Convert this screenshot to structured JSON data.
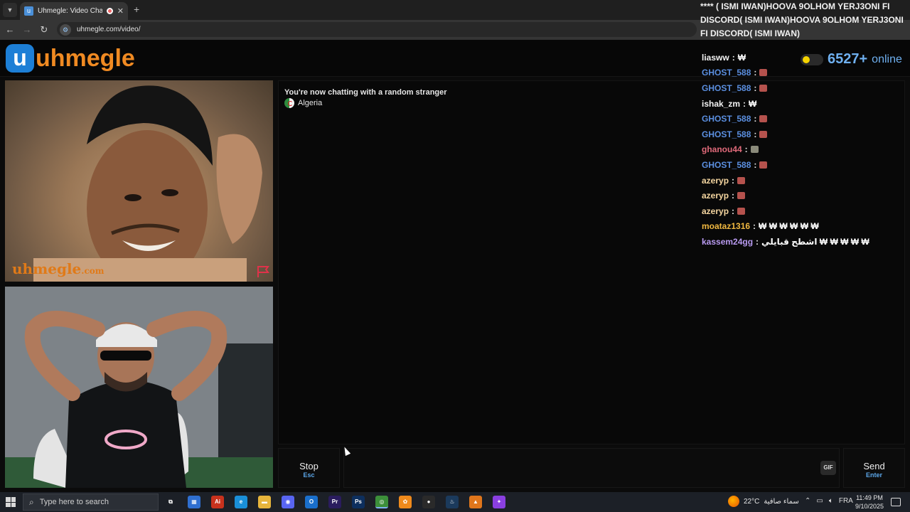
{
  "browser": {
    "tab_title": "Uhmegle: Video Chat | Ome",
    "tab_close": "✕",
    "new_tab": "+",
    "url": "uhmegle.com/video/"
  },
  "site": {
    "logo_mark": "u",
    "logo_text": "uhmegle",
    "online_count": "6527+",
    "online_label": "online"
  },
  "video": {
    "watermark_main": "uhmegle",
    "watermark_sub": ".com"
  },
  "chat": {
    "status": "You're now chatting with a random stranger",
    "country": "Algeria"
  },
  "overlay": {
    "top_text": "**** ( ISMI IWAN)HOOVA 9OLHOM YERJ3ONI FI DISCORD( ISMI IWAN)HOOVA 9OLHOM YERJ3ONI FI DISCORD( ISMI IWAN)",
    "feed": [
      {
        "user": "liasww",
        "color": "#f2f2f2",
        "msg": "₩",
        "emote": ""
      },
      {
        "user": "GHOST_588",
        "color": "#5b8fe0",
        "msg": "",
        "emote": "#b5524d"
      },
      {
        "user": "GHOST_588",
        "color": "#5b8fe0",
        "msg": "",
        "emote": "#b5524d"
      },
      {
        "user": "ishak_zm",
        "color": "#f2f2f2",
        "msg": "₩",
        "emote": ""
      },
      {
        "user": "GHOST_588",
        "color": "#5b8fe0",
        "msg": "",
        "emote": "#b5524d"
      },
      {
        "user": "GHOST_588",
        "color": "#5b8fe0",
        "msg": "",
        "emote": "#b5524d"
      },
      {
        "user": "ghanou44",
        "color": "#e06a7a",
        "msg": "",
        "emote": "#8a8a7a"
      },
      {
        "user": "GHOST_588",
        "color": "#5b8fe0",
        "msg": "",
        "emote": "#b5524d"
      },
      {
        "user": "azeryp",
        "color": "#f5d6a0",
        "msg": "",
        "emote": "#b5524d"
      },
      {
        "user": "azeryp",
        "color": "#f5d6a0",
        "msg": "",
        "emote": "#b5524d"
      },
      {
        "user": "azeryp",
        "color": "#f5d6a0",
        "msg": "",
        "emote": "#b5524d"
      },
      {
        "user": "moataz1316",
        "color": "#f0b840",
        "msg": "₩ ₩ ₩ ₩ ₩ ₩",
        "emote": ""
      },
      {
        "user": "kassem24gg",
        "color": "#b89af0",
        "msg": "اشطح قبايلي ₩ ₩ ₩ ₩ ₩",
        "emote": ""
      }
    ]
  },
  "controls": {
    "stop_label": "Stop",
    "stop_key": "Esc",
    "gif_label": "GIF",
    "send_label": "Send",
    "send_key": "Enter"
  },
  "taskbar": {
    "search_placeholder": "Type here to search",
    "apps": [
      {
        "name": "task-view",
        "label": "⧉",
        "color": "#1c2027"
      },
      {
        "name": "store",
        "label": "▦",
        "color": "#2f6fd0"
      },
      {
        "name": "adobe-ai",
        "label": "Ai",
        "color": "#c8321d"
      },
      {
        "name": "edge",
        "label": "e",
        "color": "#1a8fd8"
      },
      {
        "name": "explorer",
        "label": "▬",
        "color": "#e7b53c"
      },
      {
        "name": "discord",
        "label": "◉",
        "color": "#5865f2"
      },
      {
        "name": "outlook",
        "label": "O",
        "color": "#1a6fcc"
      },
      {
        "name": "premiere",
        "label": "Pr",
        "color": "#2a1c5e"
      },
      {
        "name": "photoshop",
        "label": "Ps",
        "color": "#0d2f5e"
      },
      {
        "name": "chrome",
        "label": "◎",
        "color": "#3c8f3a"
      },
      {
        "name": "fl-studio",
        "label": "✿",
        "color": "#ef8a1c"
      },
      {
        "name": "obs",
        "label": "●",
        "color": "#2a2a2a"
      },
      {
        "name": "steam",
        "label": "♨",
        "color": "#1b3a5c"
      },
      {
        "name": "launcher",
        "label": "▲",
        "color": "#e0761c"
      },
      {
        "name": "messenger",
        "label": "✦",
        "color": "#8a3fe0"
      }
    ],
    "temperature": "22°C",
    "weather_text": "سماء صافية",
    "language": "FRA",
    "time": "11:49 PM",
    "date": "9/10/2025"
  }
}
